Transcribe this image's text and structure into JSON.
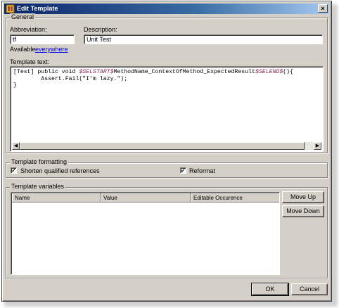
{
  "window": {
    "title": "Edit Template",
    "close_glyph": "×",
    "icon": "template-icon"
  },
  "general": {
    "group_label": "General",
    "abbreviation_label": "Abbreviation:",
    "abbreviation_value": "tf",
    "description_label": "Description:",
    "description_value": "Unit Test",
    "available_text": "Available",
    "available_link": "everywhere"
  },
  "template_text": {
    "label": "Template text:",
    "lines": [
      [
        {
          "t": "[Test] public void "
        },
        {
          "t": "$SELSTART$",
          "v": true
        },
        {
          "t": "MethodName_ContextOfMethod_ExpectedResult"
        },
        {
          "t": "$SELEND$",
          "v": true
        },
        {
          "t": "(){"
        }
      ],
      [
        {
          "t": "        Assert.Fail(\"I'm lazy.\");"
        }
      ],
      [
        {
          "t": "}"
        }
      ]
    ]
  },
  "formatting": {
    "group_label": "Template formatting",
    "shorten_label": "Shorten qualified references",
    "shorten_checked": true,
    "reformat_label": "Reformat",
    "reformat_checked": true
  },
  "variables": {
    "group_label": "Template variables",
    "columns": [
      "Name",
      "Value",
      "Editable Occurence"
    ],
    "move_up": "Move Up",
    "move_down": "Move Down"
  },
  "buttons": {
    "ok": "OK",
    "cancel": "Cancel"
  },
  "colors": {
    "title_start": "#0a246a",
    "title_end": "#a6caf0",
    "dialog_bg": "#d4d0c8",
    "variable": "#8b2252"
  }
}
